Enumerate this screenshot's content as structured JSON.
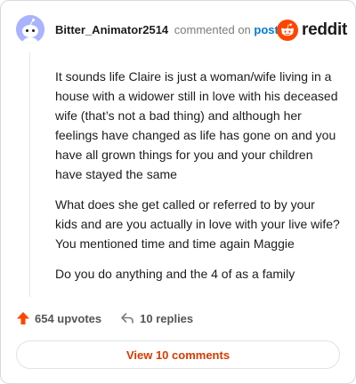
{
  "comment": {
    "username": "Bitter_Animator2514",
    "action_text": "commented on",
    "post_link_text": "post",
    "paragraphs": [
      "It sounds life Claire is just a woman/wife living in a house with a widower still in love with his deceased wife (that’s not a bad thing) and although her feelings have changed as life has gone on and you have all grown things for you and your children have stayed the same",
      "What does she get called or referred to by your kids and are you actually in love with your live wife? You mentioned time and time again Maggie",
      "Do you do anything and the 4 of as a family"
    ],
    "upvotes_text": "654 upvotes",
    "replies_text": "10 replies",
    "view_button_text": "View 10 comments"
  },
  "branding": {
    "logo_text": "reddit",
    "logo_icon": "reddit-snoo-icon"
  },
  "colors": {
    "accent": "#ff4500",
    "link": "#0079d3",
    "avatar_bg": "#a9b4ff",
    "button_text": "#d93a00"
  }
}
